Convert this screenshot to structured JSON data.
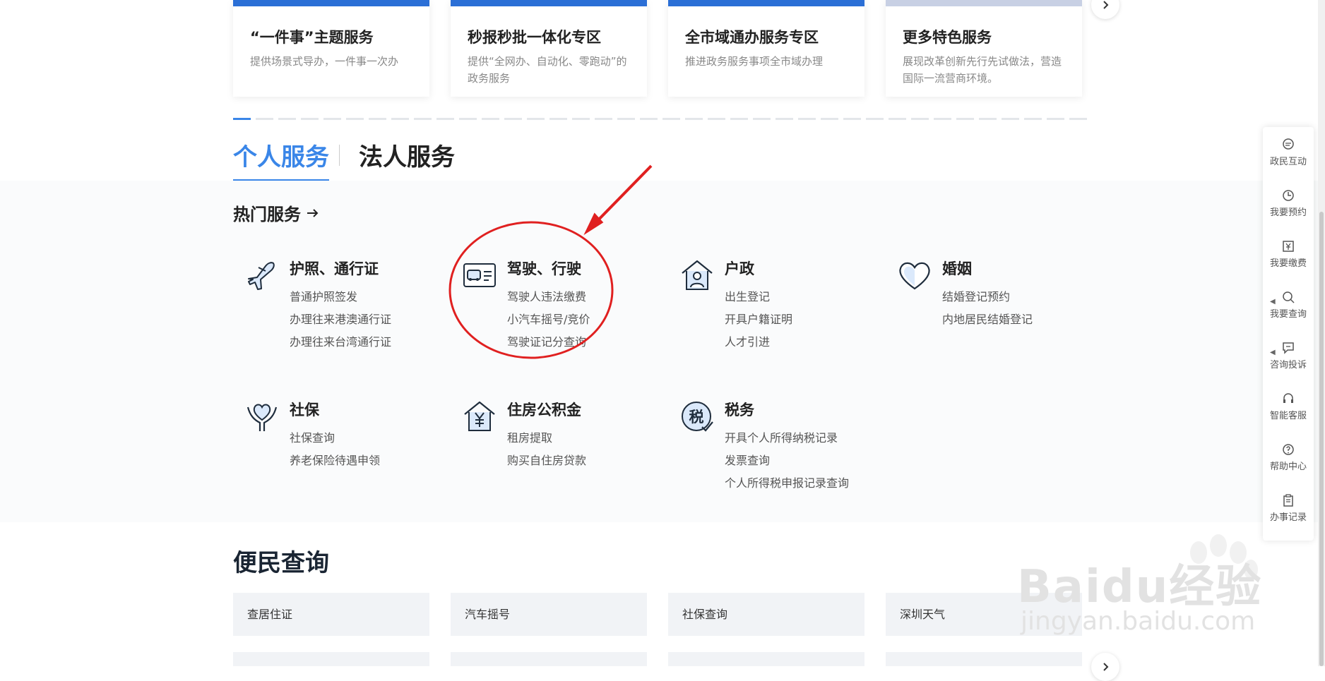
{
  "top_cards": [
    {
      "title": "“一件事”主题服务",
      "desc": "提供场景式导办，一件事一次办"
    },
    {
      "title": "秒报秒批一体化专区",
      "desc": "提供“全网办、自动化、零跑动”的政务服务"
    },
    {
      "title": "全市域通办服务专区",
      "desc": "推进政务服务事项全市域办理"
    },
    {
      "title": "更多特色服务",
      "desc": "展现改革创新先行先试做法，营造国际一流营商环境。"
    }
  ],
  "tabs": {
    "personal": "个人服务",
    "corporate": "法人服务"
  },
  "hot_services": {
    "title": "热门服务",
    "groups": [
      {
        "name": "护照、通行证",
        "icon": "airplane-icon",
        "items": [
          "普通护照签发",
          "办理往来港澳通行证",
          "办理往来台湾通行证"
        ]
      },
      {
        "name": "驾驶、行驶",
        "icon": "driver-license-icon",
        "items": [
          "驾驶人违法缴费",
          "小汽车摇号/竞价",
          "驾驶证记分查询"
        ]
      },
      {
        "name": "户政",
        "icon": "house-person-icon",
        "items": [
          "出生登记",
          "开具户籍证明",
          "人才引进"
        ]
      },
      {
        "name": "婚姻",
        "icon": "heart-icon",
        "items": [
          "结婚登记预约",
          "内地居民结婚登记"
        ]
      },
      {
        "name": "社保",
        "icon": "heart-hand-icon",
        "items": [
          "社保查询",
          "养老保险待遇申领"
        ]
      },
      {
        "name": "住房公积金",
        "icon": "house-yuan-icon",
        "items": [
          "租房提取",
          "购买自住房贷款"
        ]
      },
      {
        "name": "税务",
        "icon": "tax-icon",
        "icon_text": "税",
        "items": [
          "开具个人所得纳税记录",
          "发票查询",
          "个人所得税申报记录查询"
        ]
      }
    ]
  },
  "convenience": {
    "title": "便民查询",
    "items": [
      "查居住证",
      "汽车摇号",
      "社保查询",
      "深圳天气"
    ]
  },
  "float_bar": [
    {
      "label": "政民互动",
      "icon": "chat-icon"
    },
    {
      "label": "我要预约",
      "icon": "clock-icon"
    },
    {
      "label": "我要缴费",
      "icon": "yuan-icon"
    },
    {
      "label": "我要查询",
      "icon": "search-icon"
    },
    {
      "label": "咨询投诉",
      "icon": "comment-icon"
    },
    {
      "label": "智能客服",
      "icon": "headset-icon"
    },
    {
      "label": "帮助中心",
      "icon": "question-icon"
    },
    {
      "label": "办事记录",
      "icon": "clipboard-icon"
    }
  ],
  "watermark": {
    "brand": "Baidu经验",
    "url": "jingyan.baidu.com"
  },
  "colors": {
    "accent": "#3a86e8",
    "annotation": "#e02020"
  }
}
